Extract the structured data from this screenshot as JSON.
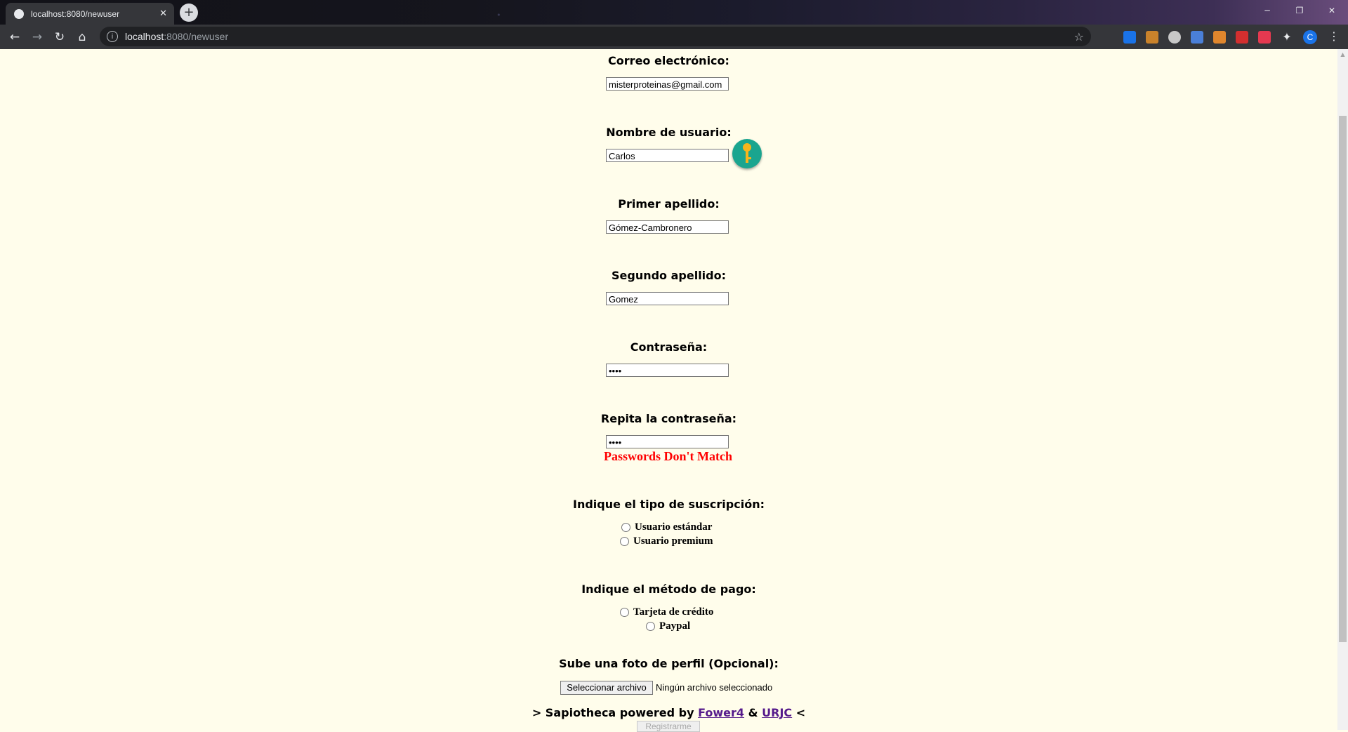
{
  "browser": {
    "tab_title": "localhost:8080/newuser",
    "tab_close": "✕",
    "new_tab": "+",
    "url_host": "localhost",
    "url_path": ":8080/newuser",
    "profile_initial": "C",
    "win_minimize": "─",
    "win_restore": "❐",
    "win_close": "✕"
  },
  "form": {
    "email": {
      "label": "Correo electrónico:",
      "value": "misterproteinas@gmail.com"
    },
    "username": {
      "label": "Nombre de usuario:",
      "value": "Carlos"
    },
    "first_surname": {
      "label": "Primer apellido:",
      "value": "Gómez-Cambronero"
    },
    "second_surname": {
      "label": "Segundo apellido:",
      "value": "Gomez"
    },
    "password": {
      "label": "Contraseña:",
      "value": "••••"
    },
    "repeat_password": {
      "label": "Repita la contraseña:",
      "value": "••••",
      "error": "Passwords Don't Match"
    },
    "subscription": {
      "label": "Indique el tipo de suscripción:",
      "options": [
        "Usuario estándar",
        "Usuario premium"
      ]
    },
    "payment": {
      "label": "Indique el método de pago:",
      "options": [
        "Tarjeta de crédito",
        "Paypal"
      ]
    },
    "photo": {
      "label": "Sube una foto de perfil (Opcional):",
      "button": "Seleccionar archivo",
      "status": "Ningún archivo seleccionado"
    },
    "submit": "Registrarme"
  },
  "footer": {
    "prefix": "> Sapiotheca powered by",
    "link1": "Fower4",
    "amp": "&",
    "link2": "URJC",
    "suffix": "<"
  },
  "colors": {
    "page_bg": "#fffdeb",
    "error": "#ff0000",
    "key_button": "#1aa58f",
    "link": "#551a8b"
  }
}
